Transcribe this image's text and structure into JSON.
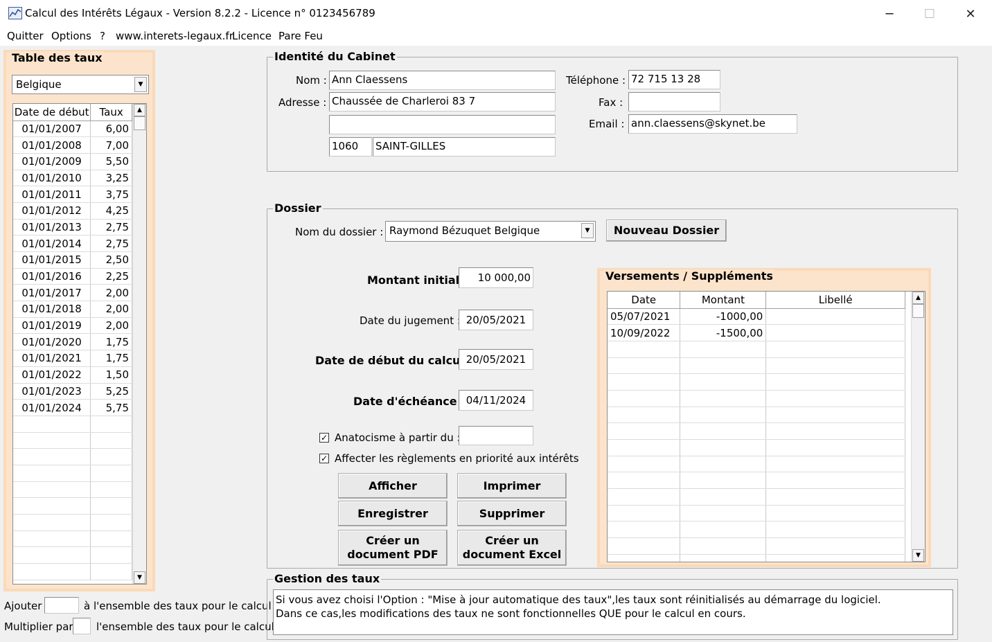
{
  "window": {
    "title": "Calcul des Intérêts Légaux - Version 8.2.2 - Licence n° 0123456789",
    "minimize": "─",
    "maximize": "☐",
    "close": "✕"
  },
  "menu": [
    "Quitter",
    "Options",
    "?",
    "www.interets-legaux.fr",
    "Licence",
    "Pare Feu"
  ],
  "taux": {
    "title": "Table des taux",
    "country": "Belgique",
    "headers": [
      "Date de début",
      "Taux"
    ],
    "rows": [
      [
        "01/01/2007",
        "6,00"
      ],
      [
        "01/01/2008",
        "7,00"
      ],
      [
        "01/01/2009",
        "5,50"
      ],
      [
        "01/01/2010",
        "3,25"
      ],
      [
        "01/01/2011",
        "3,75"
      ],
      [
        "01/01/2012",
        "4,25"
      ],
      [
        "01/01/2013",
        "2,75"
      ],
      [
        "01/01/2014",
        "2,75"
      ],
      [
        "01/01/2015",
        "2,50"
      ],
      [
        "01/01/2016",
        "2,25"
      ],
      [
        "01/01/2017",
        "2,00"
      ],
      [
        "01/01/2018",
        "2,00"
      ],
      [
        "01/01/2019",
        "2,00"
      ],
      [
        "01/01/2020",
        "1,75"
      ],
      [
        "01/01/2021",
        "1,75"
      ],
      [
        "01/01/2022",
        "1,50"
      ],
      [
        "01/01/2023",
        "5,25"
      ],
      [
        "01/01/2024",
        "5,75"
      ]
    ],
    "ajouter_label": "Ajouter",
    "ajouter_suffix": "à l'ensemble des taux pour le calcul",
    "multiplier_label": "Multiplier par",
    "multiplier_suffix": "l'ensemble des taux pour le calcul",
    "ajouter_value": "",
    "multiplier_value": ""
  },
  "cabinet": {
    "title": "Identité du Cabinet",
    "nom_label": "Nom :",
    "nom": "Ann Claessens",
    "adresse_label": "Adresse :",
    "adresse1": "Chaussée de Charleroi 83 7",
    "adresse2": "",
    "cp": "1060",
    "ville": "SAINT-GILLES",
    "tel_label": "Téléphone :",
    "tel": "72 715 13 28",
    "fax_label": "Fax :",
    "fax": "",
    "email_label": "Email :",
    "email": "ann.claessens@skynet.be"
  },
  "dossier": {
    "title": "Dossier",
    "nom_label": "Nom du dossier :",
    "nom": "Raymond Bézuquet Belgique",
    "nouveau_btn": "Nouveau Dossier",
    "montant_label": "Montant initial :",
    "montant": "10 000,00",
    "jugement_label": "Date du jugement :",
    "jugement": "20/05/2021",
    "debut_label": "Date de début du calcul :",
    "debut": "20/05/2021",
    "echeance_label": "Date d'échéance :",
    "echeance": "04/11/2024",
    "anatocisme_label": "Anatocisme à partir du :",
    "anatocisme_checked": true,
    "anatocisme_value": "",
    "affecter_label": "Affecter les règlements en priorité aux intérêts",
    "affecter_checked": true,
    "btn_afficher": "Afficher",
    "btn_imprimer": "Imprimer",
    "btn_enregistrer": "Enregistrer",
    "btn_supprimer": "Supprimer",
    "btn_pdf_l1": "Créer un",
    "btn_pdf_l2": "document PDF",
    "btn_excel_l1": "Créer un",
    "btn_excel_l2": "document Excel"
  },
  "versements": {
    "title": "Versements / Suppléments",
    "headers": [
      "Date",
      "Montant",
      "Libellé"
    ],
    "rows": [
      [
        "05/07/2021",
        "-1000,00",
        ""
      ],
      [
        "10/09/2022",
        "-1500,00",
        ""
      ]
    ]
  },
  "gestion": {
    "title": "Gestion des taux",
    "line1": "Si vous avez choisi l'Option : \"Mise à jour automatique des taux\",les taux sont réinitialisés au démarrage du logiciel.",
    "line2": "Dans ce cas,les modifications des taux ne sont fonctionnelles QUE pour le calcul en cours."
  }
}
